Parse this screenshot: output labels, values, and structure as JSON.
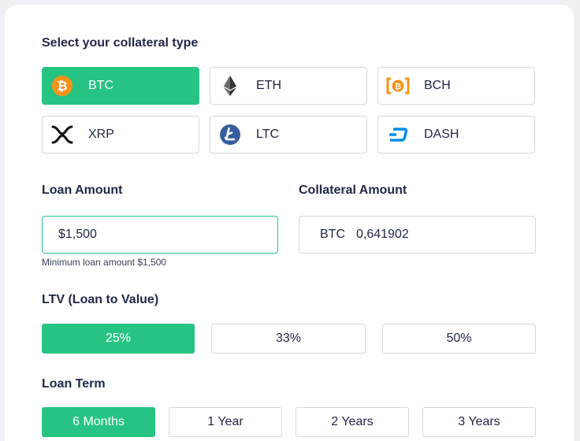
{
  "collateral": {
    "title": "Select your collateral type",
    "coins": [
      {
        "label": "BTC",
        "icon": "bitcoin-icon",
        "selected": true
      },
      {
        "label": "ETH",
        "icon": "ethereum-icon",
        "selected": false
      },
      {
        "label": "BCH",
        "icon": "bitcoin-cash-icon",
        "selected": false
      },
      {
        "label": "XRP",
        "icon": "xrp-icon",
        "selected": false
      },
      {
        "label": "LTC",
        "icon": "litecoin-icon",
        "selected": false
      },
      {
        "label": "DASH",
        "icon": "dash-icon",
        "selected": false
      }
    ]
  },
  "loan_amount": {
    "label": "Loan Amount",
    "value": "$1,500",
    "hint": "Minimum loan amount $1,500"
  },
  "collateral_amount": {
    "label": "Collateral Amount",
    "currency": "BTC",
    "value": "0,641902"
  },
  "ltv": {
    "title": "LTV (Loan to Value)",
    "options": [
      "25%",
      "33%",
      "50%"
    ],
    "selected": "25%"
  },
  "loan_term": {
    "title": "Loan Term",
    "options": [
      "6 Months",
      "1 Year",
      "2 Years",
      "3 Years"
    ],
    "selected": "6 Months"
  },
  "colors": {
    "accent": "#27c383",
    "text": "#1f2544",
    "border": "#d5d8de",
    "bitcoin": "#f7931a",
    "litecoin": "#345d9d",
    "dash": "#008ce7"
  }
}
